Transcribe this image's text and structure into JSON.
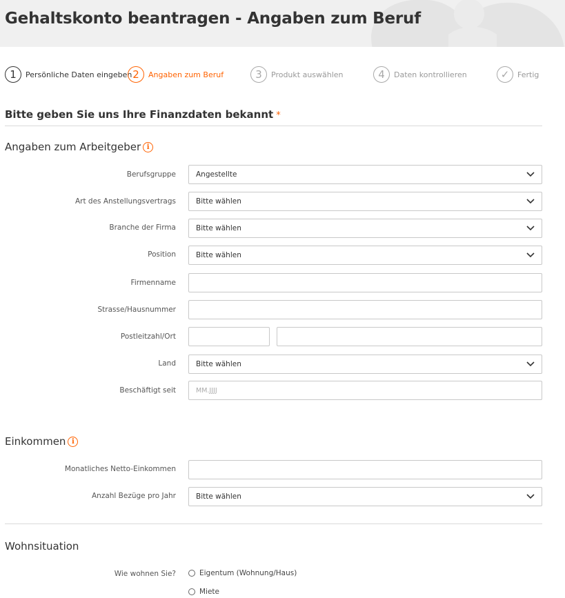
{
  "header": {
    "title": "Gehaltskonto beantragen - Angaben zum Beruf"
  },
  "steps": [
    {
      "num": "1",
      "label": "Persönliche Daten eingeben"
    },
    {
      "num": "2",
      "label": "Angaben zum Beruf"
    },
    {
      "num": "3",
      "label": "Produkt auswählen"
    },
    {
      "num": "4",
      "label": "Daten kontrollieren"
    },
    {
      "num": "✓",
      "label": "Fertig"
    }
  ],
  "finance": {
    "title": "Bitte geben Sie uns Ihre Finanzdaten bekannt",
    "required_mark": "*"
  },
  "employer": {
    "heading": "Angaben zum Arbeitgeber",
    "info_icon": "i",
    "berufsgruppe": {
      "label": "Berufsgruppe",
      "value": "Angestellte"
    },
    "vertrag": {
      "label": "Art des Anstellungsvertrags",
      "value": "Bitte wählen"
    },
    "branche": {
      "label": "Branche der Firma",
      "value": "Bitte wählen"
    },
    "position": {
      "label": "Position",
      "value": "Bitte wählen"
    },
    "firmenname": {
      "label": "Firmenname",
      "value": ""
    },
    "strasse": {
      "label": "Strasse/Hausnummer",
      "value": ""
    },
    "plz_ort": {
      "label": "Postleitzahl/Ort",
      "plz": "",
      "ort": ""
    },
    "land": {
      "label": "Land",
      "value": "Bitte wählen"
    },
    "seit": {
      "label": "Beschäftigt seit",
      "placeholder": "MM.JJJJ"
    }
  },
  "income": {
    "heading": "Einkommen",
    "info_icon": "i",
    "netto": {
      "label": "Monatliches Netto-Einkommen",
      "value": ""
    },
    "bezuege": {
      "label": "Anzahl Bezüge pro Jahr",
      "value": "Bitte wählen"
    }
  },
  "living": {
    "heading": "Wohnsituation",
    "question": "Wie wohnen Sie?",
    "options": [
      "Eigentum (Wohnung/Haus)",
      "Miete"
    ]
  },
  "colors": {
    "accent": "#ff6200",
    "text": "#333333",
    "header_bg": "#f0f0f0"
  }
}
